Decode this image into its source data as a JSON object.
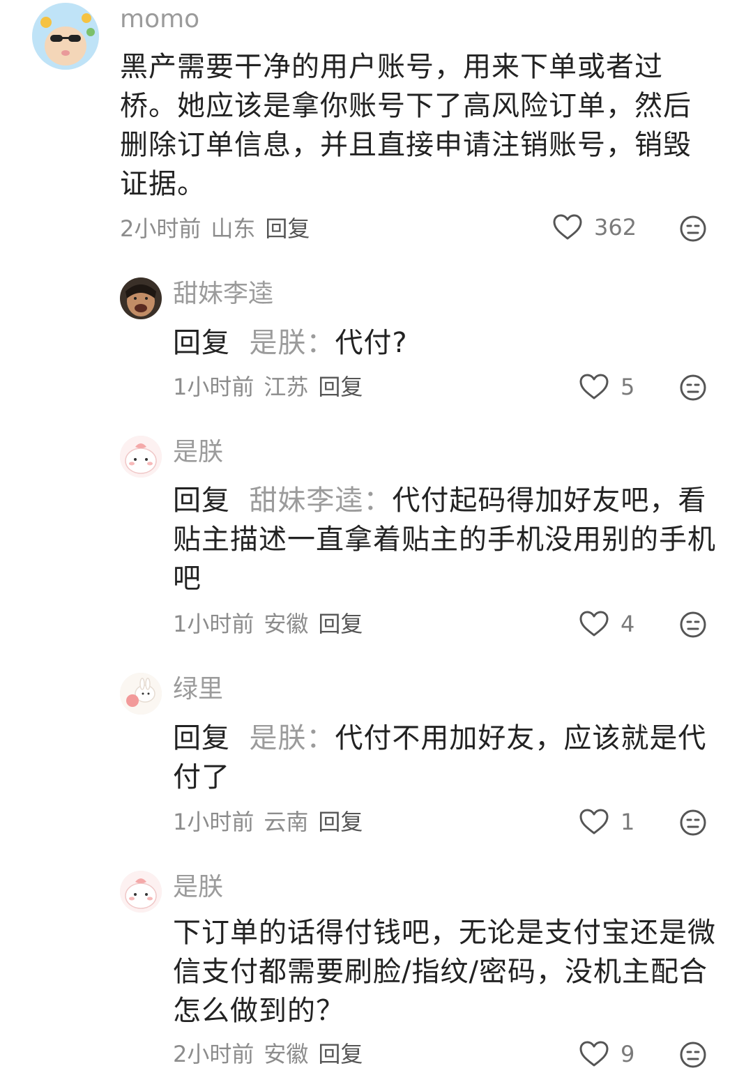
{
  "comments": [
    {
      "username": "momo",
      "text": "黑产需要干净的用户账号，用来下单或者过桥。她应该是拿你账号下了高风险订单，然后删除订单信息，并且直接申请注销账号，销毁证据。",
      "time": "2小时前",
      "location": "山东",
      "reply_label": "回复",
      "likes": "362"
    },
    {
      "username": "甜妹李逵",
      "reply_prefix": "回复",
      "reply_target": "是朕：",
      "text": "代付?",
      "time": "1小时前",
      "location": "江苏",
      "reply_label": "回复",
      "likes": "5"
    },
    {
      "username": "是朕",
      "reply_prefix": "回复",
      "reply_target": "甜妹李逵：",
      "text": "代付起码得加好友吧，看贴主描述一直拿着贴主的手机没用别的手机吧",
      "time": "1小时前",
      "location": "安徽",
      "reply_label": "回复",
      "likes": "4"
    },
    {
      "username": "绿里",
      "reply_prefix": "回复",
      "reply_target": "是朕：",
      "text": "代付不用加好友，应该就是代付了",
      "time": "1小时前",
      "location": "云南",
      "reply_label": "回复",
      "likes": "1"
    },
    {
      "username": "是朕",
      "text": "下订单的话得付钱吧，无论是支付宝还是微信支付都需要刷脸/指纹/密码，没机主配合怎么做到的？",
      "time": "2小时前",
      "location": "安徽",
      "reply_label": "回复",
      "likes": "9"
    }
  ],
  "icons": {
    "like": "heart-outline-icon",
    "dislike": "meh-face-icon"
  },
  "colors": {
    "text": "#222222",
    "muted": "#9b9b9b",
    "background": "#ffffff"
  }
}
